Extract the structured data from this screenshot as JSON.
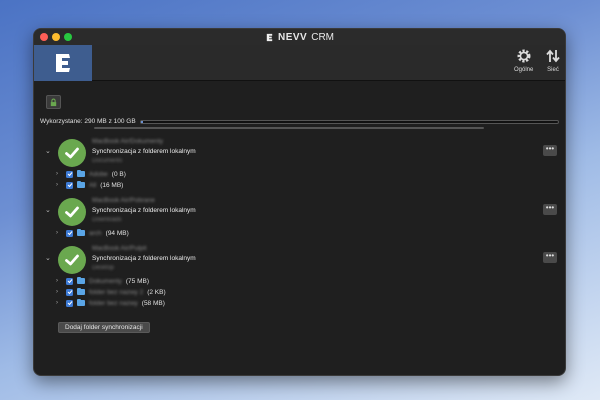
{
  "window": {
    "app_brand": "NEVV",
    "app_suffix": "CRM",
    "traffic_colors": [
      "#ff5f57",
      "#febc2e",
      "#28c840"
    ]
  },
  "toolbar": {
    "general_label": "Ogólne",
    "network_label": "Sieć"
  },
  "usage": {
    "label": "Wykorzystane: 290 MB z 100 GB",
    "fraction": 0.003
  },
  "accounts": [
    {
      "path": "MacBook Air/Dokumenty",
      "status": "Synchronizacja z folderem lokalnym",
      "local_folder": "Documents",
      "more": "•••",
      "folders": [
        {
          "name": "Adobe",
          "size": "(0 B)"
        },
        {
          "name": "All",
          "size": "(16 MB)"
        }
      ]
    },
    {
      "path": "MacBook Air/Pobrane",
      "status": "Synchronizacja z folderem lokalnym",
      "local_folder": "Downloads",
      "more": "•••",
      "folders": [
        {
          "name": "arch",
          "size": "(94 MB)"
        }
      ]
    },
    {
      "path": "MacBook Air/Pulpit",
      "status": "Synchronizacja z folderem lokalnym",
      "local_folder": "Desktop",
      "more": "•••",
      "folders": [
        {
          "name": "Dokumenty",
          "size": "(75 MB)"
        },
        {
          "name": "folder bez nazwy 2",
          "size": "(2 KB)"
        },
        {
          "name": "folder bez nazwy",
          "size": "(58 MB)"
        }
      ]
    }
  ],
  "add_button_label": "Dodaj folder synchronizacji",
  "colors": {
    "accent": "#3e5d8f",
    "check_green": "#6aa84f",
    "checkbox_blue": "#3d7bd6",
    "folder_blue": "#5aa5e6"
  }
}
